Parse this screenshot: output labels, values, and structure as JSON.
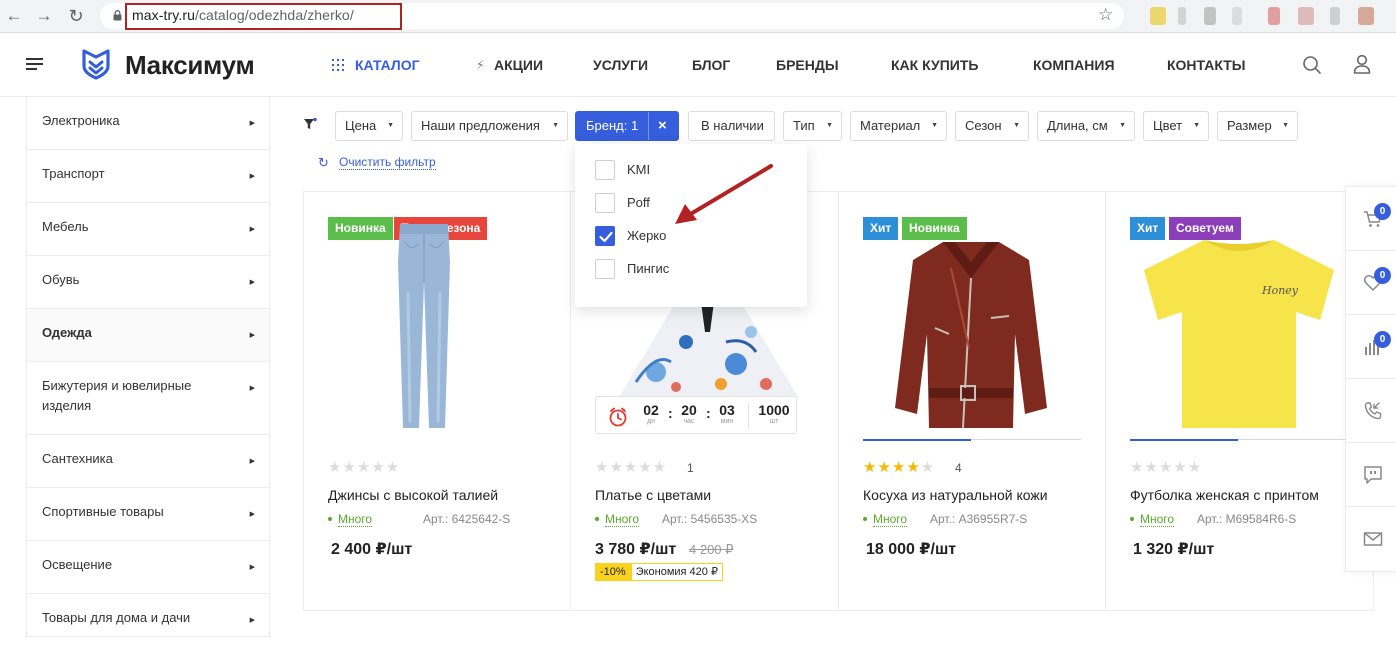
{
  "browser": {
    "url_domain": "max-try.ru",
    "url_path": "/catalog/odezhda/zherko/"
  },
  "header": {
    "logo_text": "Максимум",
    "nav": [
      "КАТАЛОГ",
      "АКЦИИ",
      "УСЛУГИ",
      "БЛОГ",
      "БРЕНДЫ",
      "КАК КУПИТЬ",
      "КОМПАНИЯ",
      "КОНТАКТЫ"
    ]
  },
  "sidebar": {
    "items": [
      {
        "label": "Электроника"
      },
      {
        "label": "Транспорт"
      },
      {
        "label": "Мебель"
      },
      {
        "label": "Обувь"
      },
      {
        "label": "Одежда",
        "active": true
      },
      {
        "label": "Бижутерия и ювелирные изделия"
      },
      {
        "label": "Сантехника"
      },
      {
        "label": "Спортивные товары"
      },
      {
        "label": "Освещение"
      },
      {
        "label": "Товары для дома и дачи"
      }
    ]
  },
  "filters": {
    "chips": [
      "Цена",
      "Наши предложения",
      "Бренд: 1",
      "В наличии",
      "Тип",
      "Материал",
      "Сезон",
      "Длина, см",
      "Цвет",
      "Размер"
    ],
    "clear_label": "Очистить фильтр",
    "brand_dropdown": [
      {
        "label": "KMI",
        "checked": false
      },
      {
        "label": "Poff",
        "checked": false
      },
      {
        "label": "Жерко",
        "checked": true
      },
      {
        "label": "Пингис",
        "checked": false
      }
    ]
  },
  "products": [
    {
      "badges": [
        {
          "text": "Новинка",
          "kind": "new"
        },
        {
          "text": "Тренд сезона",
          "kind": "trend"
        }
      ],
      "rating": 0,
      "reviews": "",
      "name": "Джинсы с высокой талией",
      "stock": "Много",
      "article": "Арт.: 6425642-S",
      "price": "2 400 ₽/шт"
    },
    {
      "badges": [],
      "rating": 0,
      "reviews": "1",
      "name": "Платье с цветами",
      "stock": "Много",
      "article": "Арт.: 5456535-XS",
      "price": "3 780 ₽/шт",
      "old_price": "4 200 ₽",
      "discount": "-10%",
      "economy": "Экономия 420 ₽",
      "timer": {
        "days": "02",
        "days_lbl": "дн",
        "hours": "20",
        "hours_lbl": "час",
        "mins": "03",
        "mins_lbl": "мин",
        "qty": "1000",
        "qty_lbl": "шт"
      }
    },
    {
      "badges": [
        {
          "text": "Хит",
          "kind": "hit"
        },
        {
          "text": "Новинка",
          "kind": "new"
        }
      ],
      "rating": 4,
      "reviews": "4",
      "name": "Косуха из натуральной кожи",
      "stock": "Много",
      "article": "Арт.: A36955R7-S",
      "price": "18 000 ₽/шт"
    },
    {
      "badges": [
        {
          "text": "Хит",
          "kind": "hit"
        },
        {
          "text": "Советуем",
          "kind": "adv"
        }
      ],
      "rating": 0,
      "reviews": "",
      "name": "Футболка женская с принтом",
      "stock": "Много",
      "article": "Арт.: M69584R6-S",
      "price": "1 320 ₽/шт",
      "print_text": "Honey"
    }
  ],
  "side_panel": {
    "cart_count": "0",
    "favorites_count": "0",
    "compare_count": "0"
  },
  "colors": {
    "accent": "#365edc",
    "badge_new": "#5bbd4a",
    "badge_trend": "#e8453c",
    "badge_hit": "#2d8fd7",
    "badge_adv": "#8c3fb8",
    "annotation": "#b22222"
  }
}
